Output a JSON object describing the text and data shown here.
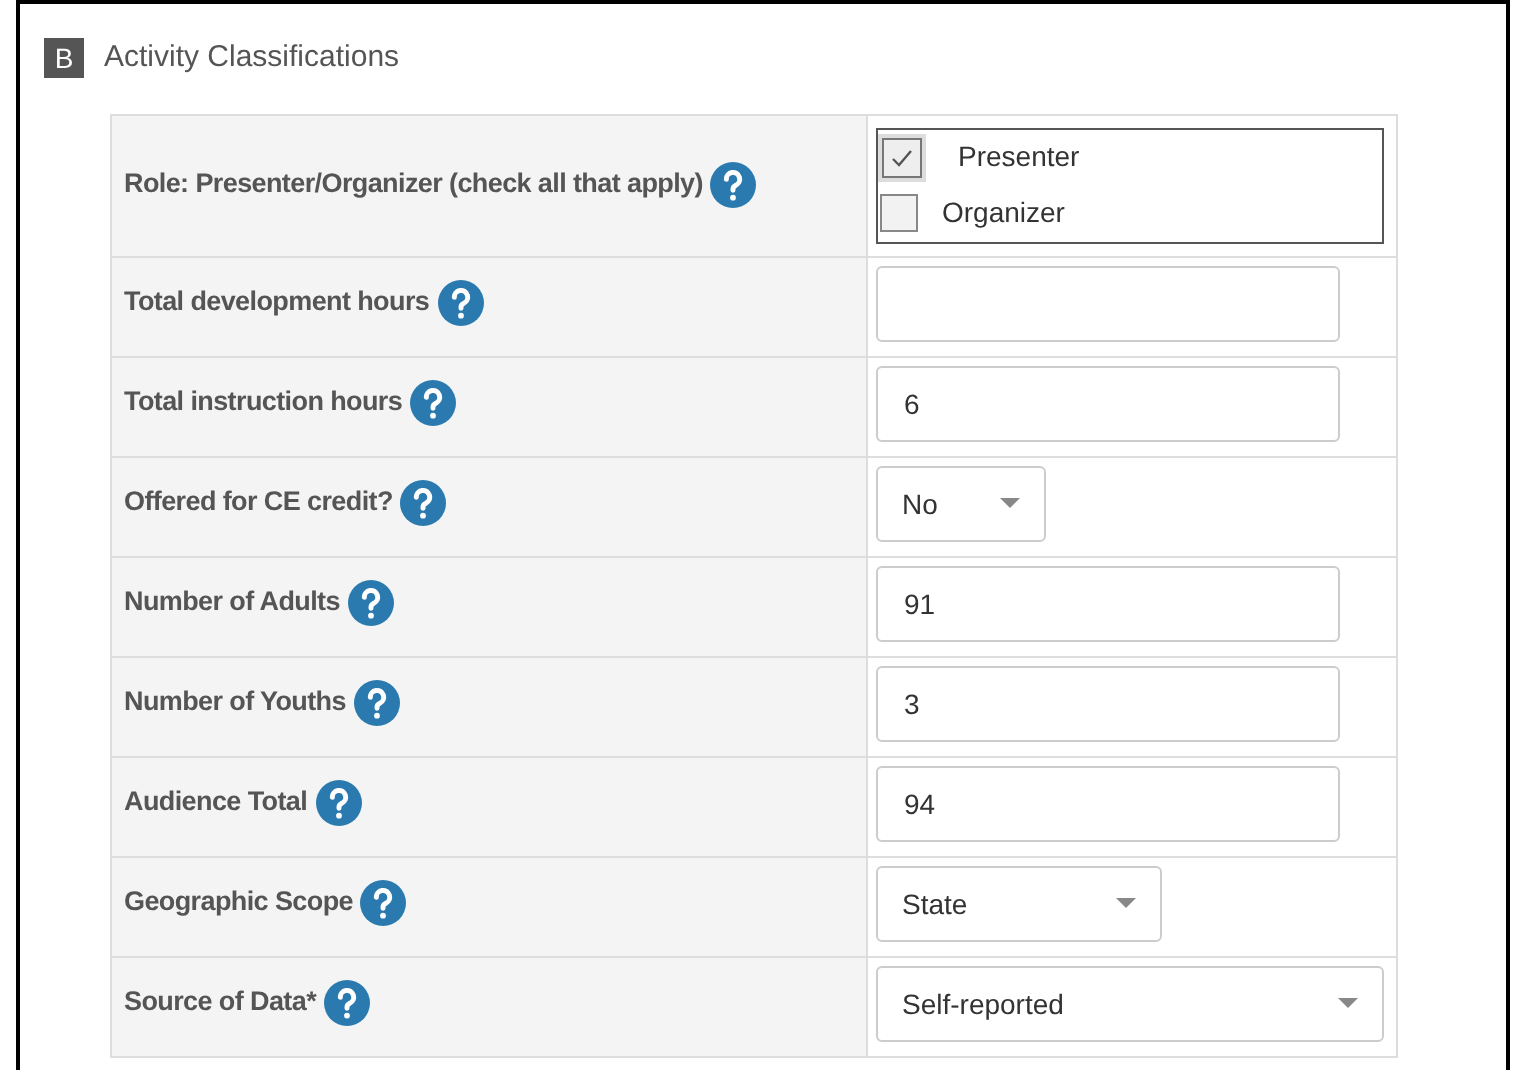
{
  "section": {
    "badge": "B",
    "title": "Activity Classifications"
  },
  "fields": [
    {
      "kind": "checkboxes",
      "label": "Role: Presenter/Organizer (check all that apply)",
      "options": [
        {
          "label": "Presenter",
          "checked": true
        },
        {
          "label": "Organizer",
          "checked": false
        }
      ]
    },
    {
      "kind": "text",
      "label": "Total development hours"
    },
    {
      "kind": "text",
      "label": "Total instruction hours",
      "value": "6"
    },
    {
      "kind": "select",
      "label": "Offered for CE credit?",
      "value": "No"
    },
    {
      "kind": "text",
      "label": "Number of Adults",
      "value": "91"
    },
    {
      "kind": "text",
      "label": "Number of Youths",
      "value": "3"
    },
    {
      "kind": "text",
      "label": "Audience Total",
      "value": "94"
    },
    {
      "kind": "select",
      "label": "Geographic Scope",
      "value": "State"
    },
    {
      "kind": "select",
      "label": "Source of Data*",
      "value": "Self-reported"
    }
  ]
}
